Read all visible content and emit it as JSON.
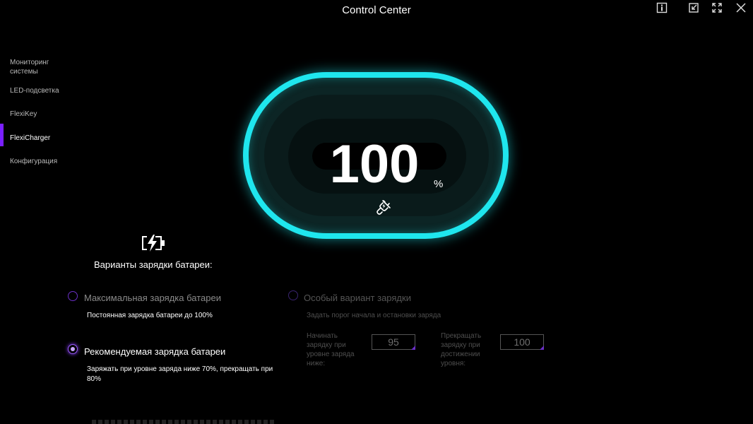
{
  "window": {
    "title": "Control Center"
  },
  "sidebar": {
    "items": [
      {
        "label": "Мониторинг системы",
        "active": false
      },
      {
        "label": "LED-подсветка",
        "active": false
      },
      {
        "label": "FlexiKey",
        "active": false
      },
      {
        "label": "FlexiCharger",
        "active": true
      },
      {
        "label": "Конфигурация",
        "active": false
      }
    ]
  },
  "gauge": {
    "value": "100",
    "unit": "%",
    "ring_color": "#1fe6ee",
    "status_icon": "plug-charging-icon"
  },
  "charging": {
    "heading": "Варианты зарядки батареи:",
    "heading_icon": "battery-charging-icon",
    "options": {
      "max": {
        "label": "Максимальная зарядка батареи",
        "description": "Постоянная зарядка батареи до 100%",
        "selected": false
      },
      "recommended": {
        "label": "Рекомендуемая зарядка батареи",
        "description": "Заряжать при уровне заряда ниже 70%, прекращать при 80%",
        "selected": true
      },
      "custom": {
        "label": "Особый вариант зарядки",
        "description": "Задать порог начала и остановки заряда",
        "selected": false,
        "enabled": false,
        "start_label": "Начинать зарядку при уровне заряда ниже:",
        "start_value": "95",
        "stop_label": "Прекращать зарядку при достижении уровня:",
        "stop_value": "100"
      }
    }
  },
  "colors": {
    "accent": "#7a1fff",
    "cyan": "#1fe6ee"
  }
}
